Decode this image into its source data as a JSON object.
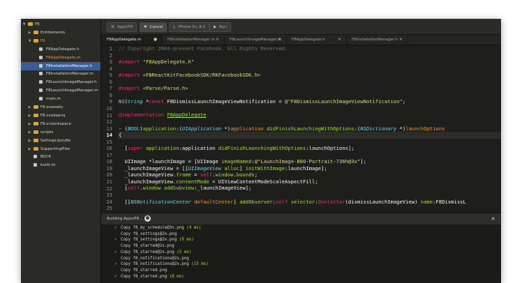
{
  "sidebar": {
    "items": [
      {
        "label": "F8",
        "kind": "folder",
        "arrow": "down"
      },
      {
        "label": "Entitlements",
        "kind": "folder",
        "arrow": "right"
      },
      {
        "label": "F8",
        "kind": "folder",
        "arrow": "down",
        "accent": true
      },
      {
        "label": "F8AppDelegate.h",
        "kind": "file"
      },
      {
        "label": "F8AppDelegate.m",
        "kind": "file",
        "accent": true
      },
      {
        "label": "F8InstallationManager.h",
        "kind": "file",
        "selected": true
      },
      {
        "label": "F8InstallationManager.m",
        "kind": "file"
      },
      {
        "label": "F8LaunchImageManager.h",
        "kind": "file"
      },
      {
        "label": "F8LaunchImageManager.m",
        "kind": "file"
      },
      {
        "label": "main.m",
        "kind": "file"
      },
      {
        "label": "F8.xcassets",
        "kind": "folder",
        "arrow": "right"
      },
      {
        "label": "F8.xcodeproj",
        "kind": "folder",
        "arrow": "right"
      },
      {
        "label": "F8.xcworkspace",
        "kind": "folder",
        "arrow": "right"
      },
      {
        "label": "scripts",
        "kind": "folder",
        "arrow": "right"
      },
      {
        "label": "Settings.bundle",
        "kind": "folder",
        "arrow": "right"
      },
      {
        "label": "SupportingFiles",
        "kind": "folder",
        "arrow": "right"
      },
      {
        "label": "BUCK",
        "kind": "file"
      },
      {
        "label": "build.sh",
        "kind": "file"
      }
    ]
  },
  "toolbar": {
    "target_label": "Apps/F8",
    "cancel_label": "Cancel",
    "device_label": "iPhone 5s, 8.2",
    "run_label": "Run"
  },
  "tabs": [
    {
      "label": "F8AppDelegate.m",
      "active": true,
      "close": "●"
    },
    {
      "label": "F8InstallationManager.m",
      "close": "×"
    },
    {
      "label": "F8LaunchImageManager.m",
      "close": "×"
    },
    {
      "label": "F8AppDelegate.h",
      "close": "×"
    },
    {
      "label": "F8InstallationManager.h",
      "close": "×"
    }
  ],
  "editor": {
    "current_line": 14,
    "line_numbers": [
      1,
      2,
      3,
      4,
      5,
      6,
      7,
      8,
      9,
      10,
      11,
      12,
      13,
      14,
      15,
      16,
      17,
      18,
      19,
      20,
      21,
      22,
      23,
      24,
      25
    ]
  },
  "build": {
    "title": "Building Apps/F8...",
    "close_label": "×",
    "lines": [
      {
        "text": "Copy f8_my_schedule@3x.png",
        "time": "(4 ms)",
        "check": true
      },
      {
        "text": "Copy f8_settings@2x.png",
        "time": "",
        "check": false
      },
      {
        "text": "Copy f8_settings@2x.png",
        "time": "(9 ms)",
        "check": true
      },
      {
        "text": "Copy f8_starred@2x.png",
        "time": "",
        "check": false
      },
      {
        "text": "Copy f8_starred@2x.png",
        "time": "(5 ms)",
        "check": true
      },
      {
        "text": "Copy f8_notifications@2x.png",
        "time": "",
        "check": false
      },
      {
        "text": "Copy f8_notifications@2x.png",
        "time": "(15 ms)",
        "check": true
      },
      {
        "text": "Copy f8_starred.png",
        "time": "",
        "check": false
      },
      {
        "text": "Copy f8_starred.png",
        "time": "(8 ms)",
        "check": true
      }
    ]
  }
}
